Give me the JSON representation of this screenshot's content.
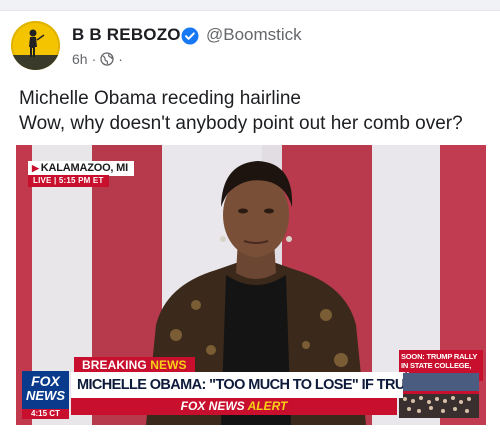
{
  "post": {
    "author_name": "B B REBOZO",
    "handle": "@Boomstick",
    "time": "6h",
    "separator": "·",
    "text_line1": "Michelle Obama receding hairline",
    "text_line2": "Wow, why doesn't anybody point out her comb over?"
  },
  "video": {
    "location": "KALAMAZOO, MI",
    "live_label": "LIVE | 5:15 PM ET",
    "breaking_label": "BREAKING",
    "breaking_news_label": "NEWS",
    "headline": "MICHELLE OBAMA: \"TOO MUCH TO LOSE\" IF TRUMP WINS",
    "alert_brand": "FOX NEWS",
    "alert_word": "ALERT",
    "logo_line1": "FOX",
    "logo_line2": "NEWS",
    "logo_time": "4:15 CT",
    "soon_text": "SOON: TRUMP RALLY IN STATE COLLEGE, PA"
  },
  "colors": {
    "fox_red": "#c8102e",
    "fox_blue": "#0a3a8c",
    "alert_yellow": "#f7d117",
    "verified_blue": "#1877f2"
  }
}
